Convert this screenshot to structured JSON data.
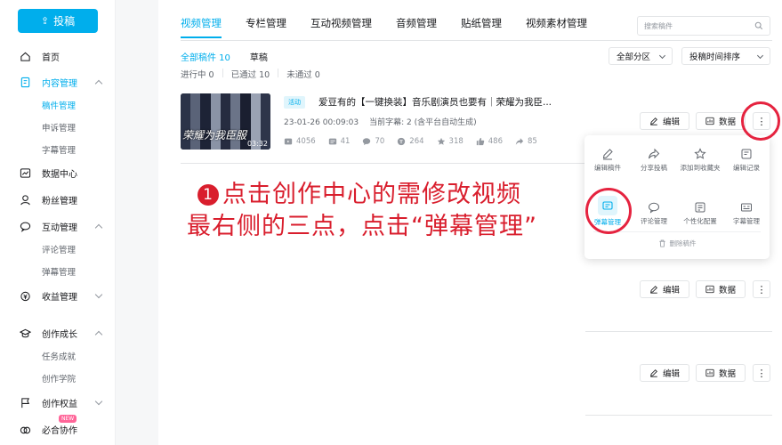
{
  "sidebar": {
    "upload_label": "投稿",
    "items": [
      {
        "label": "首页",
        "icon": "home-icon"
      },
      {
        "label": "内容管理",
        "icon": "content-icon"
      },
      {
        "sub": "稿件管理"
      },
      {
        "sub": "申诉管理"
      },
      {
        "sub": "字幕管理"
      },
      {
        "label": "数据中心",
        "icon": "chart-icon"
      },
      {
        "label": "粉丝管理",
        "icon": "user-icon"
      },
      {
        "label": "互动管理",
        "icon": "chat-icon"
      },
      {
        "sub": "评论管理"
      },
      {
        "sub": "弹幕管理"
      },
      {
        "label": "收益管理",
        "icon": "money-icon"
      },
      {
        "label": "创作成长",
        "icon": "grad-icon"
      },
      {
        "sub": "任务成就"
      },
      {
        "sub": "创作学院"
      },
      {
        "label": "创作权益",
        "icon": "flag-icon"
      },
      {
        "label": "必合协作",
        "icon": "coop-icon",
        "badge": "NEW"
      }
    ]
  },
  "tabs": [
    "视频管理",
    "专栏管理",
    "互动视频管理",
    "音频管理",
    "贴纸管理",
    "视频素材管理"
  ],
  "search_placeholder": "搜索稿件",
  "filters": {
    "all": "全部稿件 10",
    "draft": "草稿",
    "in_progress": "进行中 0",
    "passed": "已通过 10",
    "not_passed": "未通过 0",
    "zone": "全部分区",
    "sort": "投稿时间排序"
  },
  "video": {
    "tag": "活动",
    "title": "爱豆有的【一键换装】音乐剧演员也要有｜荣耀为我臣...",
    "thumb_text": "荣耀为我臣服",
    "duration": "03:32",
    "date": "23-01-26 00:09:03",
    "subtitle": "当前字幕: 2 (含平台自动生成)",
    "stats": [
      "4056",
      "41",
      "70",
      "264",
      "318",
      "486",
      "85"
    ]
  },
  "actions": {
    "edit": "编辑",
    "data": "数据",
    "more": "⋮"
  },
  "popup": {
    "items": [
      "编辑稿件",
      "分享投稿",
      "添加到收藏夹",
      "编辑记录",
      "弹幕管理",
      "评论管理",
      "个性化配置",
      "字幕管理"
    ],
    "delete": "删除稿件"
  },
  "annotation": {
    "num": "1",
    "line1": "点击创作中心的需修改视频",
    "line2": "最右侧的三点，点击“弹幕管理”"
  },
  "colors": {
    "accent": "#00aeec",
    "annotation": "#d91e2d",
    "circle": "#e5233f"
  }
}
